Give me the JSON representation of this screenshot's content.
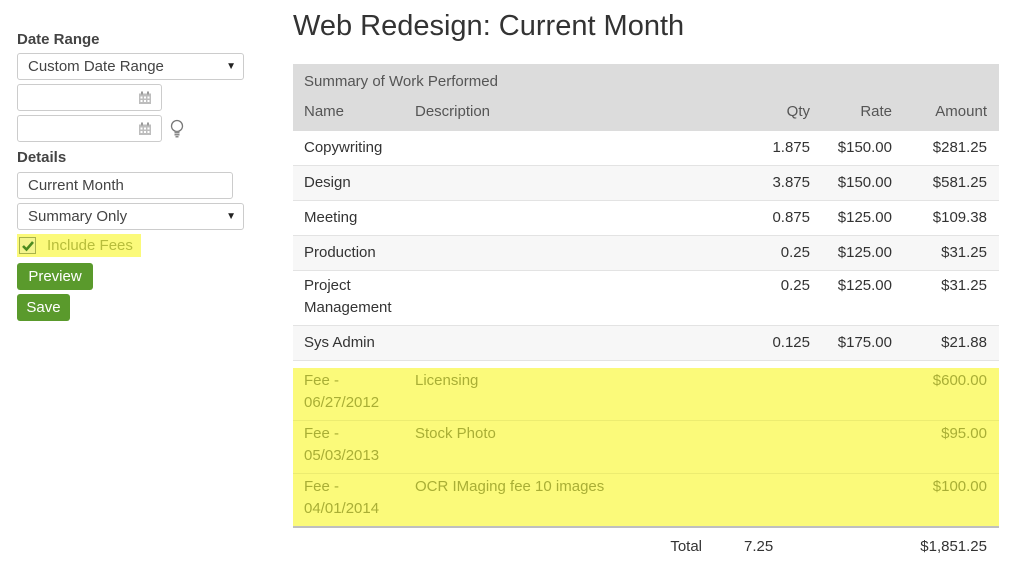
{
  "sidebar": {
    "date_range_label": "Date Range",
    "date_range_select": "Custom Date Range",
    "start_date": "",
    "end_date": "",
    "details_label": "Details",
    "title_input": "Current Month",
    "detail_select": "Summary Only",
    "include_fees_label": "Include Fees",
    "include_fees_checked": true,
    "preview_button": "Preview",
    "save_button": "Save"
  },
  "page": {
    "title": "Web Redesign: Current Month"
  },
  "report": {
    "section_title": "Summary of Work Performed",
    "columns": {
      "name": "Name",
      "description": "Description",
      "qty": "Qty",
      "rate": "Rate",
      "amount": "Amount"
    },
    "rows": [
      {
        "name": "Copywriting",
        "description": "",
        "qty": "1.875",
        "rate": "$150.00",
        "amount": "$281.25"
      },
      {
        "name": "Design",
        "description": "",
        "qty": "3.875",
        "rate": "$150.00",
        "amount": "$581.25"
      },
      {
        "name": "Meeting",
        "description": "",
        "qty": "0.875",
        "rate": "$125.00",
        "amount": "$109.38"
      },
      {
        "name": "Production",
        "description": "",
        "qty": "0.25",
        "rate": "$125.00",
        "amount": "$31.25"
      },
      {
        "name": "Project Management",
        "description": "",
        "qty": "0.25",
        "rate": "$125.00",
        "amount": "$31.25"
      },
      {
        "name": "Sys Admin",
        "description": "",
        "qty": "0.125",
        "rate": "$175.00",
        "amount": "$21.88"
      }
    ],
    "fees": [
      {
        "name": "Fee - 06/27/2012",
        "description": "Licensing",
        "amount": "$600.00"
      },
      {
        "name": "Fee - 05/03/2013",
        "description": "Stock Photo",
        "amount": "$95.00"
      },
      {
        "name": "Fee - 04/01/2014",
        "description": "OCR IMaging fee 10 images",
        "amount": "$100.00"
      }
    ],
    "total": {
      "label": "Total",
      "qty": "7.25",
      "amount": "$1,851.25"
    }
  },
  "colors": {
    "highlight": "#fbfa7a",
    "button": "#5a9a2c",
    "header_band": "#dcdcdc"
  }
}
